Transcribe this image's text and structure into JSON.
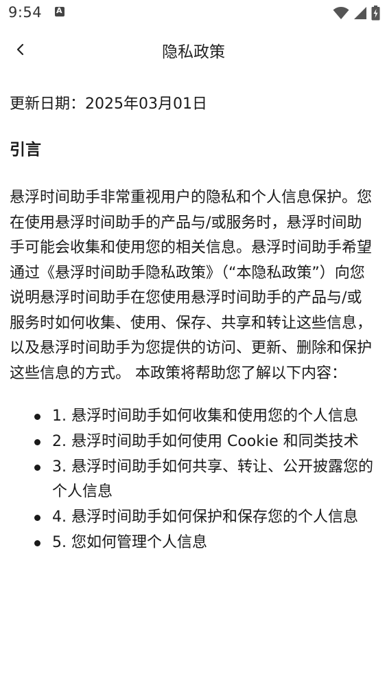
{
  "status_bar": {
    "time": "9:54",
    "icons": [
      "notification-icon",
      "wifi-icon",
      "signal-icon",
      "battery-icon"
    ]
  },
  "nav": {
    "back_icon": "chevron-left-icon",
    "title": "隐私政策"
  },
  "policy": {
    "update_date": "更新日期：2025年03月01日",
    "section_heading": "引言",
    "intro": "悬浮时间助手非常重视用户的隐私和个人信息保护。您在使用悬浮时间助手的产品与/或服务时，悬浮时间助手可能会收集和使用您的相关信息。悬浮时间助手希望通过《悬浮时间助手隐私政策》（“本隐私政策”）向您说明悬浮时间助手在您使用悬浮时间助手的产品与/或服务时如何收集、使用、保存、共享和转让这些信息，以及悬浮时间助手为您提供的访问、更新、删除和保护这些信息的方式。 本政策将帮助您了解以下内容：",
    "toc": [
      "1. 悬浮时间助手如何收集和使用您的个人信息",
      "2. 悬浮时间助手如何使用 Cookie 和同类技术",
      "3. 悬浮时间助手如何共享、转让、公开披露您的个人信息",
      "4. 悬浮时间助手如何保护和保存您的个人信息",
      "5. 您如何管理个人信息"
    ]
  }
}
